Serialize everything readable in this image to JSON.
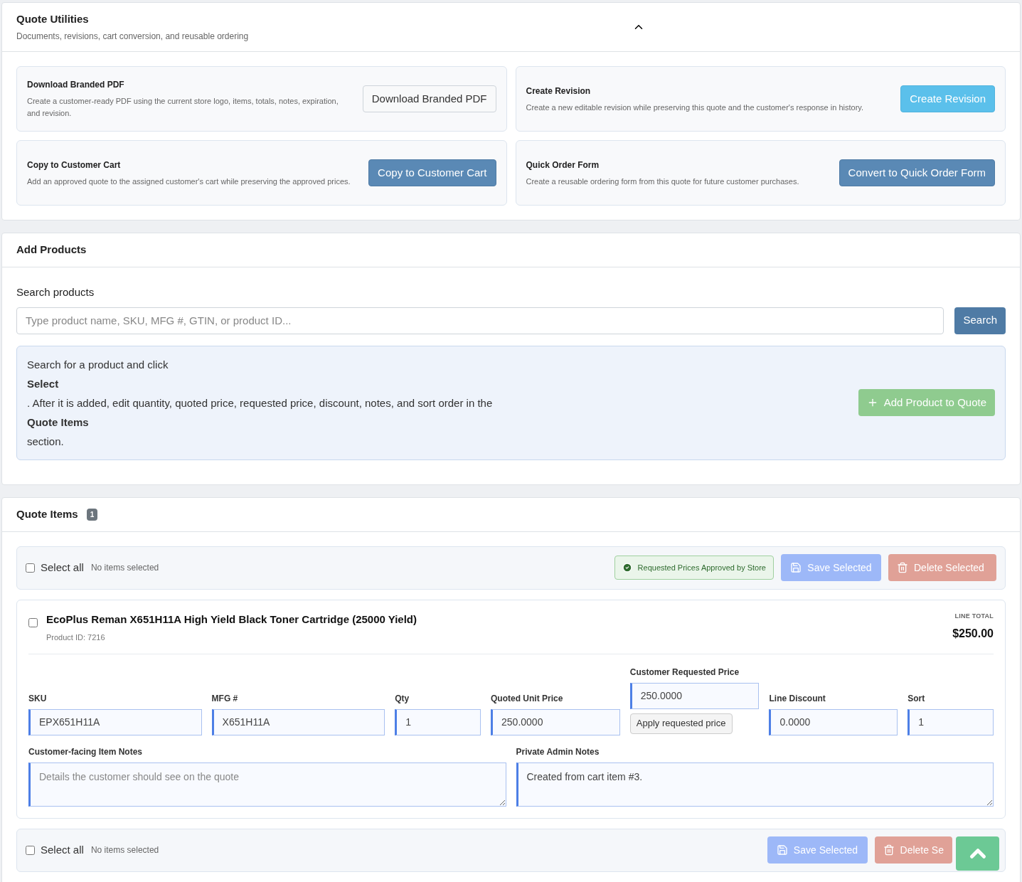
{
  "utilities": {
    "title": "Quote Utilities",
    "subtitle": "Documents, revisions, cart conversion, and reusable ordering",
    "expanded": true,
    "actions": [
      {
        "title": "Download Branded PDF",
        "description": "Create a customer-ready PDF using the current store logo, items, totals, notes, expiration, and revision.",
        "button": "Download Branded PDF",
        "kind": "outline"
      },
      {
        "title": "Create Revision",
        "description": "Create a new editable revision while preserving this quote and the customer's response in history.",
        "button": "Create Revision",
        "kind": "info"
      },
      {
        "title": "Copy to Customer Cart",
        "description": "Add an approved quote to the assigned customer's cart while preserving the approved prices.",
        "button": "Copy to Customer Cart",
        "kind": "primary"
      },
      {
        "title": "Quick Order Form",
        "description": "Create a reusable ordering form from this quote for future customer purchases.",
        "button": "Convert to Quick Order Form",
        "kind": "primary"
      }
    ]
  },
  "add_products": {
    "title": "Add Products",
    "search_label": "Search products",
    "search_placeholder": "Type product name, SKU, MFG #, GTIN, or product ID...",
    "search_button": "Search",
    "help": [
      {
        "kind": "text",
        "text": "Search for a product and click"
      },
      {
        "kind": "strong",
        "text": "Select"
      },
      {
        "kind": "text",
        "text": ". After it is added, edit quantity, quoted price, requested price, discount, notes, and sort order in the"
      },
      {
        "kind": "strong",
        "text": "Quote Items"
      },
      {
        "kind": "text",
        "text": "section."
      }
    ],
    "add_button": "Add Product to Quote",
    "add_disabled": true
  },
  "quote_items": {
    "title": "Quote Items",
    "count": "1",
    "toolbar_top": {
      "select_all": "Select all",
      "checked": false,
      "status": "No items selected",
      "approval": "Requested Prices Approved by Store",
      "save": "Save Selected",
      "delete": "Delete Selected",
      "disabled": true
    },
    "items": [
      {
        "name": "EcoPlus Reman X651H11A High Yield Black Toner Cartridge (25000 Yield)",
        "product_id": "Product ID: 7216",
        "checked": false,
        "line_total_label": "LINE TOTAL",
        "line_total": "$250.00",
        "fields": [
          {
            "label": "SKU",
            "value": "EPX651H11A"
          },
          {
            "label": "MFG #",
            "value": "X651H11A"
          },
          {
            "label": "Qty",
            "value": "1"
          },
          {
            "label": "Quoted Unit Price",
            "value": "250.0000"
          },
          {
            "label": "Customer Requested Price",
            "value": "250.0000",
            "button": "Apply requested price"
          },
          {
            "label": "Line Discount",
            "value": "0.0000"
          },
          {
            "label": "Sort",
            "value": "1"
          }
        ],
        "customer_notes": {
          "label": "Customer-facing Item Notes",
          "placeholder": "Details the customer should see on the quote"
        },
        "admin_notes": {
          "label": "Private Admin Notes",
          "value": "Created from cart item #3."
        }
      }
    ],
    "toolbar_bottom": {
      "select_all": "Select all",
      "checked": false,
      "status": "No items selected",
      "save": "Save Selected",
      "delete": "Delete Se",
      "disabled": true
    }
  }
}
